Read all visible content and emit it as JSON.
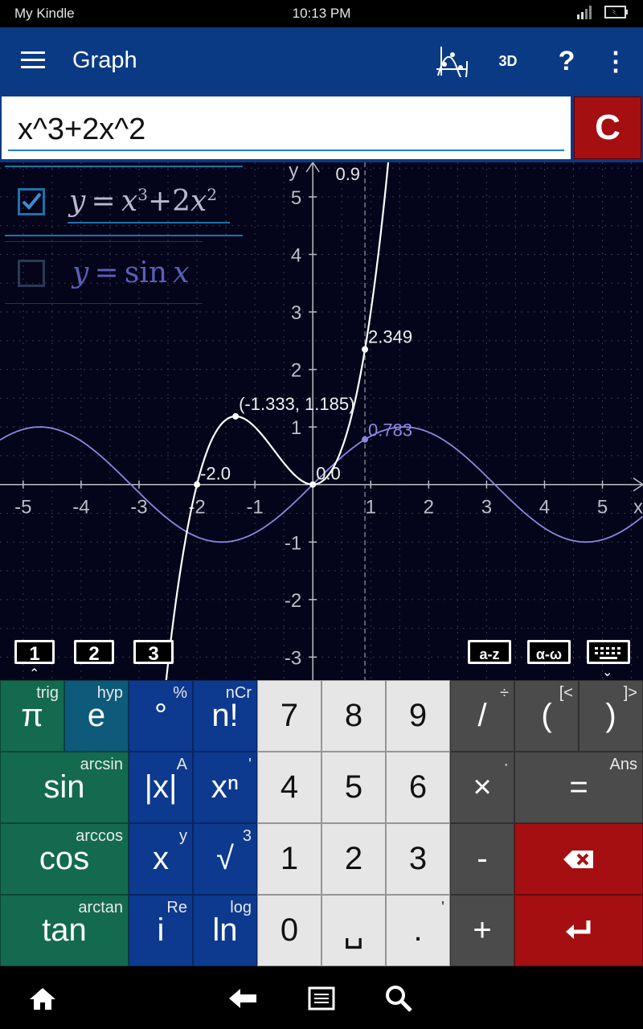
{
  "status": {
    "device": "My Kindle",
    "time": "10:13 PM"
  },
  "appbar": {
    "title": "Graph",
    "threed_label": "3D",
    "help_label": "?",
    "more_label": "⋮"
  },
  "input": {
    "value": "x^3+2x^2",
    "clear_label": "C"
  },
  "functions": [
    {
      "checked": true,
      "color": "#b8b8d0"
    },
    {
      "checked": false,
      "color": "#6b6fd0"
    }
  ],
  "chart_data": [
    {
      "type": "line",
      "xlim": [
        -5.4,
        5.7
      ],
      "ylim": [
        -3.4,
        5.6
      ],
      "x_ticks": [
        -5,
        -4,
        -3,
        -2,
        -1,
        1,
        2,
        3,
        4,
        5
      ],
      "y_ticks": [
        -3,
        -2,
        -1,
        1,
        2,
        3,
        4,
        5
      ],
      "xlabel": "x",
      "ylabel": "y",
      "grid": true,
      "series": [
        {
          "expr": "x^3+2x^2",
          "color": "#ffffff"
        },
        {
          "expr": "sin x",
          "color": "#8c86e0"
        }
      ],
      "points": [
        {
          "x": -2.0,
          "y": 0,
          "label": "-2.0"
        },
        {
          "x": -1.333,
          "y": 1.185,
          "label": "(-1.333, 1.185)"
        },
        {
          "x": 0,
          "y": 0,
          "label": "0.0"
        },
        {
          "x": 0.9,
          "y": 2.349,
          "label": "2.349"
        },
        {
          "x": 0.9,
          "y": 0.783,
          "label": "0.783"
        }
      ],
      "trace_x": 0.9,
      "trace_label": "0.9"
    }
  ],
  "tabs": {
    "t1": "1",
    "t2": "2",
    "t3": "3",
    "az": "a-z",
    "aw": "α-ω"
  },
  "keys": {
    "pi": "π",
    "pi_sup": "trig",
    "e": "e",
    "e_sup": "hyp",
    "deg": "°",
    "deg_sup": "%",
    "fact": "n!",
    "fact_sup": "nCr",
    "k7": "7",
    "k8": "8",
    "k9": "9",
    "div": "/",
    "div_sup": "÷",
    "lp": "(",
    "lp_sup": "[<",
    "rp": ")",
    "rp_sup": "]>",
    "sin": "sin",
    "sin_sup": "arcsin",
    "abs": "|x|",
    "abs_sup": "A",
    "pow": "xⁿ",
    "pow_sup": "'",
    "k4": "4",
    "k5": "5",
    "k6": "6",
    "mul": "×",
    "mul_sup": "·",
    "eq": "=",
    "eq_sup": "Ans",
    "cos": "cos",
    "cos_sup": "arccos",
    "x": "x",
    "x_sup": "y",
    "sqrt": "√",
    "sqrt_sup": "3",
    "k1": "1",
    "k2": "2",
    "k3": "3",
    "minus": "-",
    "tan": "tan",
    "tan_sup": "arctan",
    "i": "i",
    "i_sup": "Re",
    "ln": "ln",
    "ln_sup": "log",
    "k0": "0",
    "space": "␣",
    "dot": ".",
    "dot_sup": "'",
    "plus": "+"
  }
}
